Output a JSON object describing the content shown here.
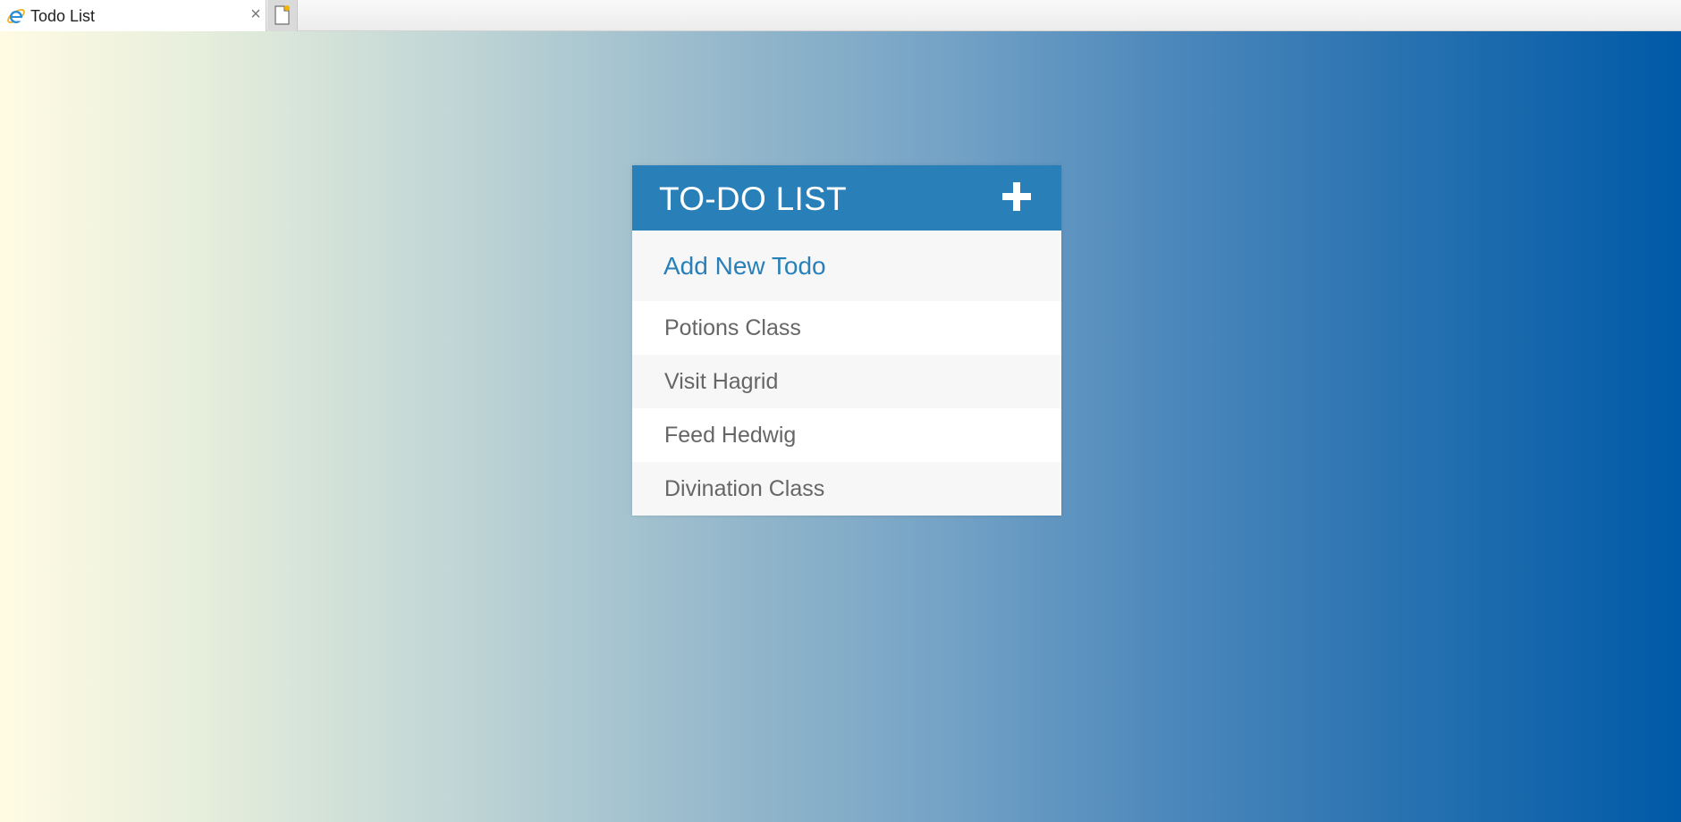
{
  "browser": {
    "tab": {
      "title": "Todo List",
      "icon": "internet-explorer-icon",
      "close_glyph": "×"
    },
    "new_tab_icon": "new-tab-icon"
  },
  "app": {
    "header": {
      "title": "TO-DO LIST",
      "add_icon": "plus-icon",
      "color": "#2980b9"
    },
    "new_todo": {
      "placeholder": "Add New Todo",
      "value": ""
    },
    "todos": [
      {
        "text": "Potions Class"
      },
      {
        "text": "Visit Hagrid"
      },
      {
        "text": "Feed Hedwig"
      },
      {
        "text": "Divination Class"
      }
    ],
    "colors": {
      "accent": "#2980b9",
      "item_text": "#666666",
      "background_start": "#fffbe3",
      "background_end": "#005aa7"
    }
  }
}
